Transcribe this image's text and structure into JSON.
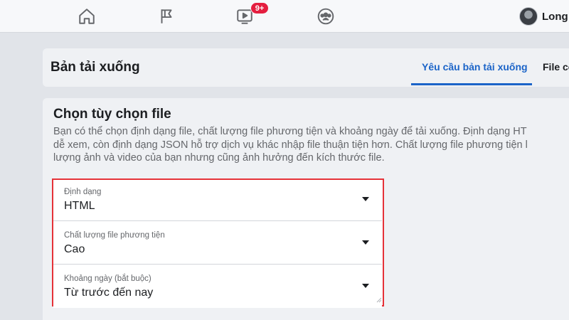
{
  "nav": {
    "badge": "9+",
    "icons": [
      "home-icon",
      "flag-icon",
      "video-icon",
      "groups-icon"
    ],
    "profile_name": "Long"
  },
  "header": {
    "title": "Bản tải xuống",
    "tabs": [
      {
        "label": "Yêu cầu bản tải xuống",
        "active": true
      },
      {
        "label": "File có"
      }
    ]
  },
  "section": {
    "title": "Chọn tùy chọn file",
    "description": "Bạn có thể chọn định dạng file, chất lượng file phương tiện và khoảng ngày để tải xuống. Định dạng HT\ndễ xem, còn định dạng JSON hỗ trợ dịch vụ khác nhập file thuận tiện hơn. Chất lượng file phương tiện l\nlượng ảnh và video của bạn nhưng cũng ảnh hưởng đến kích thước file."
  },
  "fields": [
    {
      "label": "Định dạng",
      "value": "HTML"
    },
    {
      "label": "Chất lượng file phương tiện",
      "value": "Cao"
    },
    {
      "label": "Khoảng ngày (bắt buộc)",
      "value": "Từ trước đến nay"
    }
  ],
  "colors": {
    "accent": "#1b64c8",
    "highlight_border": "#e53238",
    "badge": "#e41e3f"
  }
}
